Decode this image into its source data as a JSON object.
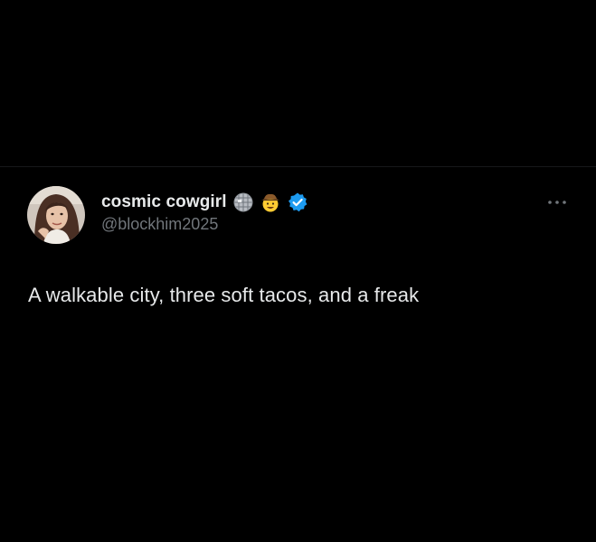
{
  "tweet": {
    "author": {
      "display_name": "cosmic cowgirl",
      "handle": "@blockhim2025",
      "badges": [
        "disco-ball-icon",
        "cowboy-face-icon",
        "verified-badge-icon"
      ]
    },
    "text": "A walkable city, three soft tacos, and a freak",
    "more_icon": "more-options-icon"
  },
  "colors": {
    "background": "#000000",
    "primary_text": "#e7e9ea",
    "secondary_text": "#71767b",
    "verified": "#1d9bf0",
    "divider": "#16181a"
  }
}
